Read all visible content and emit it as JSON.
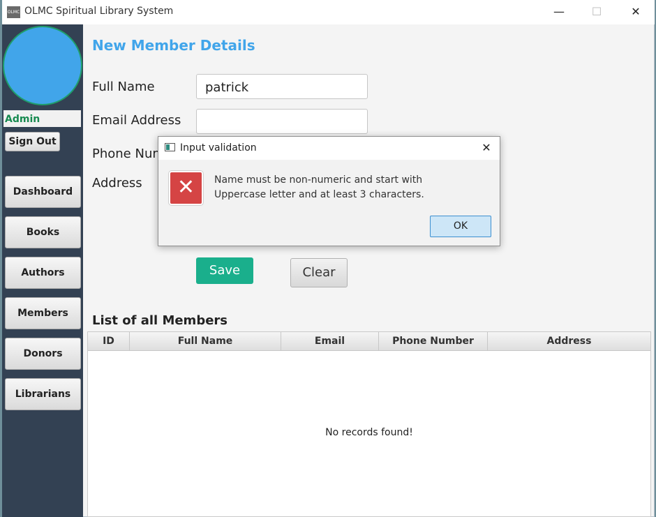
{
  "window": {
    "app_icon_text": "OLMC",
    "title": "OLMC Spiritual Library System",
    "minimize_glyph": "—",
    "maximize_glyph": "☐",
    "close_glyph": "✕"
  },
  "sidebar": {
    "role": "Admin",
    "sign_out": "Sign Out",
    "items": [
      {
        "label": "Dashboard"
      },
      {
        "label": "Books"
      },
      {
        "label": "Authors"
      },
      {
        "label": "Members"
      },
      {
        "label": "Donors"
      },
      {
        "label": "Librarians"
      }
    ]
  },
  "form": {
    "title": "New Member Details",
    "full_name_label": "Full Name",
    "full_name_value": "patrick",
    "email_label": "Email Address",
    "email_value": "",
    "phone_label": "Phone Num",
    "address_label": "Address",
    "save_label": "Save",
    "clear_label": "Clear"
  },
  "members_table": {
    "title": "List of all Members",
    "columns": [
      "ID",
      "Full Name",
      "Email",
      "Phone Number",
      "Address"
    ],
    "empty_message": "No records found!"
  },
  "dialog": {
    "title": "Input validation",
    "close_glyph": "✕",
    "message_line1": "Name must be non-numeric and start with",
    "message_line2": "Uppercase letter and at least 3 characters.",
    "ok_label": "OK",
    "error_glyph": "✕"
  },
  "colors": {
    "accent_blue": "#41a5ea",
    "sidebar_bg": "#334153",
    "save_green": "#1aaf8c",
    "error_red": "#d54444"
  }
}
